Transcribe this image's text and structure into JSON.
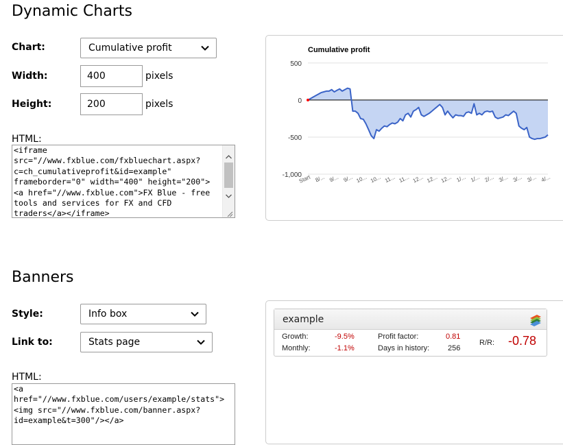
{
  "dynamic_charts": {
    "title": "Dynamic Charts",
    "chart_label": "Chart:",
    "chart_value": "Cumulative profit",
    "width_label": "Width:",
    "width_value": "400",
    "width_unit": "pixels",
    "height_label": "Height:",
    "height_value": "200",
    "height_unit": "pixels",
    "html_label": "HTML:",
    "html_lines": [
      "<iframe",
      "src=\"//www.fxblue.com/fxbluechart.aspx?",
      "c=ch_cumulativeprofit&id=example\"",
      "frameborder=\"0\" width=\"400\" height=\"200\">",
      "<a href=\"//www.fxblue.com\">FX Blue - free",
      "tools and services for FX and CFD",
      "traders</a></iframe>"
    ]
  },
  "chart_data": {
    "type": "area",
    "title": "Cumulative profit",
    "ylim": [
      -1000,
      600
    ],
    "yticks": [
      500,
      0,
      -500,
      -1000
    ],
    "ytick_labels": [
      "500",
      "0",
      "-500",
      "-1,000"
    ],
    "xtick_labels": [
      "Start",
      "8/...",
      "9/...",
      "9/...",
      "10...",
      "10...",
      "11...",
      "11...",
      "12...",
      "12...",
      "12...",
      "1/...",
      "1/...",
      "2/...",
      "3/...",
      "3/...",
      "3/...",
      "4/..."
    ],
    "grid": true,
    "fill_color": "#c5d5f3",
    "line_color": "#3a63c7",
    "start_marker_color": "#ff0000",
    "values": [
      0,
      20,
      40,
      60,
      80,
      100,
      110,
      120,
      120,
      140,
      110,
      130,
      150,
      120,
      140,
      160,
      150,
      -150,
      -150,
      -180,
      -250,
      -260,
      -320,
      -400,
      -480,
      -520,
      -400,
      -420,
      -380,
      -350,
      -360,
      -330,
      -310,
      -320,
      -300,
      -250,
      -280,
      -200,
      -180,
      -230,
      -150,
      -130,
      -100,
      -200,
      -220,
      -200,
      -180,
      -150,
      -120,
      -90,
      -60,
      -100,
      -200,
      -150,
      -200,
      -240,
      -200,
      -210,
      -210,
      -220,
      -170,
      -160,
      -180,
      -50,
      -200,
      -180,
      -200,
      -160,
      -150,
      -160,
      -150,
      -230,
      -250,
      -240,
      -230,
      -200,
      -210,
      -180,
      -150,
      -180,
      -350,
      -380,
      -400,
      -370,
      -500,
      -520,
      -530,
      -520,
      -520,
      -510,
      -500,
      -470
    ]
  },
  "banners": {
    "title": "Banners",
    "style_label": "Style:",
    "style_value": "Info box",
    "link_label": "Link to:",
    "link_value": "Stats page",
    "html_label": "HTML:",
    "html_lines": [
      "<a",
      "href=\"//www.fxblue.com/users/example/stats\">",
      "<img src=\"//www.fxblue.com/banner.aspx?",
      "id=example&t=300\"/></a>"
    ]
  },
  "banner_box": {
    "name": "example",
    "growth_label": "Growth:",
    "growth_value": "-9.5%",
    "monthly_label": "Monthly:",
    "monthly_value": "-1.1%",
    "profit_factor_label": "Profit factor:",
    "profit_factor_value": "0.81",
    "days_label": "Days in history:",
    "days_value": "256",
    "rr_label": "R/R:",
    "rr_value": "-0.78",
    "logo_icon": "fxblue-stacked-logo-icon"
  }
}
